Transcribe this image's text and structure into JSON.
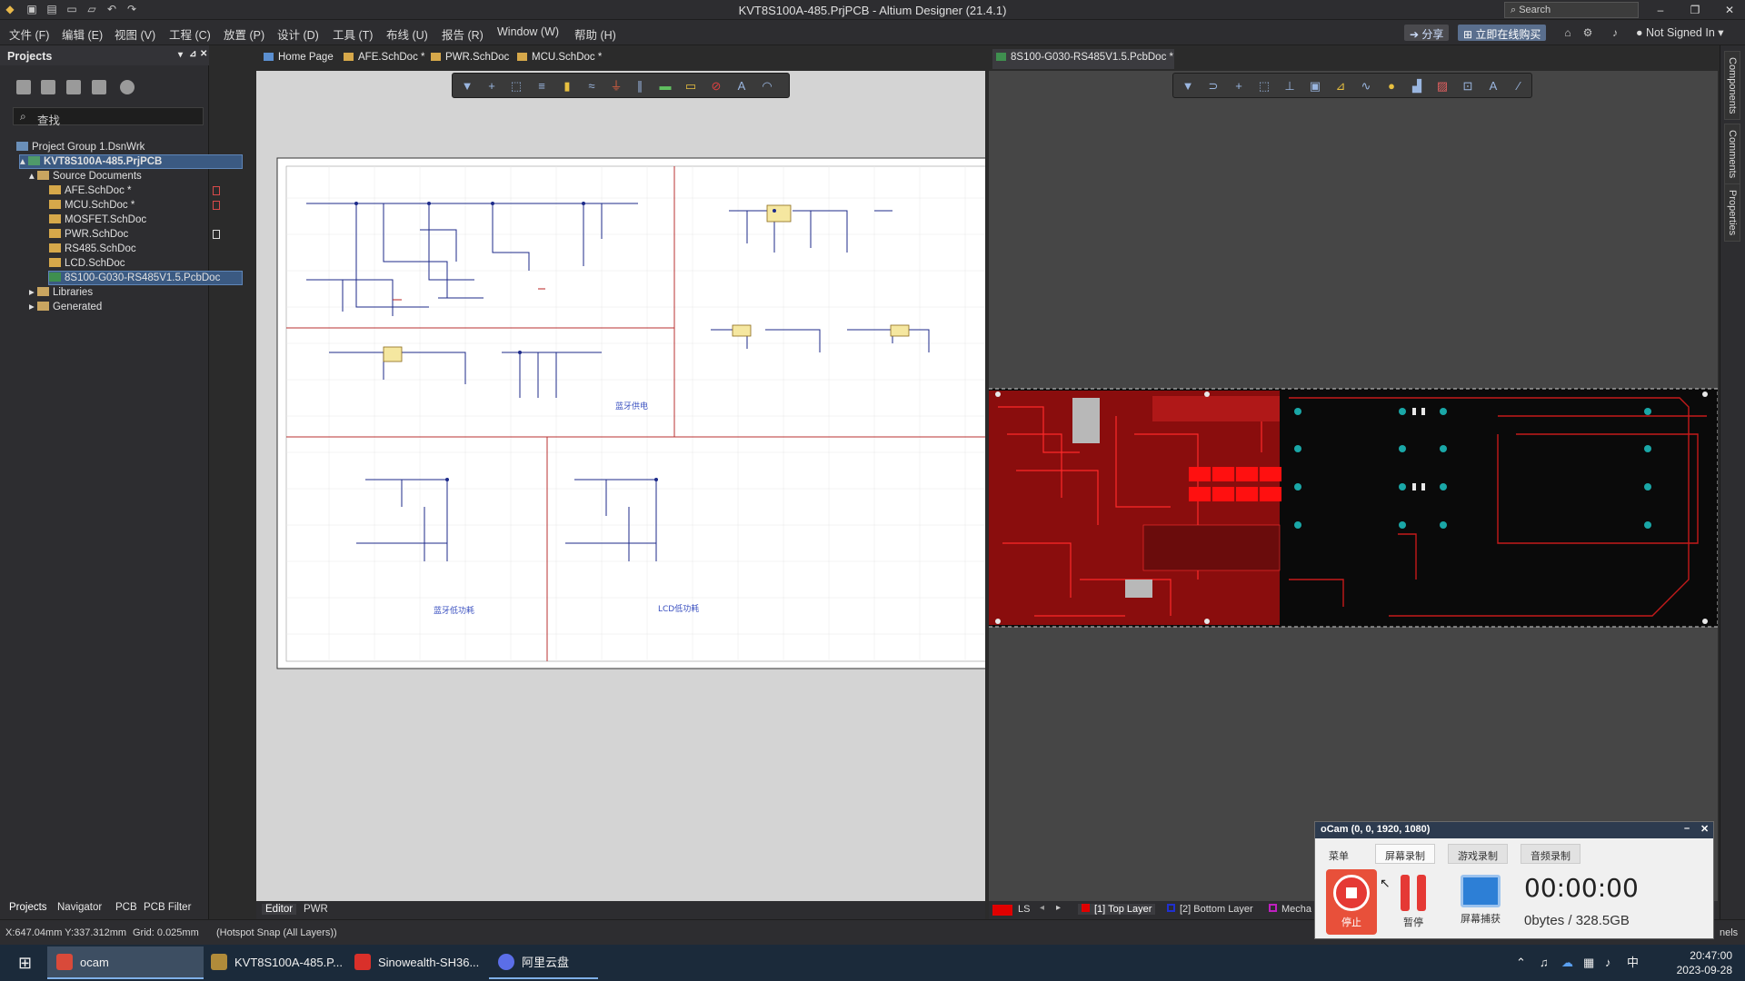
{
  "app": {
    "title": "KVT8S100A-485.PrjPCB - Altium Designer (21.4.1)",
    "search_placeholder": "Search",
    "share_label": "分享",
    "buy_label": "立即在线购买",
    "account_label": "Not Signed In"
  },
  "menu": [
    "文件 (F)",
    "编辑 (E)",
    "视图 (V)",
    "工程 (C)",
    "放置 (P)",
    "设计 (D)",
    "工具 (T)",
    "布线 (U)",
    "报告 (R)",
    "Window (W)",
    "帮助 (H)"
  ],
  "projects": {
    "title": "Projects",
    "search_placeholder": "查找",
    "group": "Project Group 1.DsnWrk",
    "project": "KVT8S100A-485.PrjPCB",
    "source_folder": "Source Documents",
    "files": [
      "AFE.SchDoc *",
      "MCU.SchDoc *",
      "MOSFET.SchDoc",
      "PWR.SchDoc",
      "RS485.SchDoc",
      "LCD.SchDoc",
      "8S100-G030-RS485V1.5.PcbDoc"
    ],
    "other_folders": [
      "Libraries",
      "Generated"
    ],
    "bottom_tabs": [
      "Projects",
      "Navigator",
      "PCB",
      "PCB Filter"
    ]
  },
  "doc_tabs": [
    "Home Page",
    "AFE.SchDoc *",
    "PWR.SchDoc",
    "MCU.SchDoc *"
  ],
  "pcb_tab": "8S100-G030-RS485V1.5.PcbDoc *",
  "schematic": {
    "notes": [
      "蓝牙供电",
      "蓝牙低功耗",
      "LCD低功耗"
    ]
  },
  "editor_tabs": [
    "Editor",
    "PWR"
  ],
  "layer_bar": {
    "ls": "LS",
    "layers": [
      {
        "label": "[1] Top Layer",
        "color": "#e00000"
      },
      {
        "label": "[2] Bottom Layer",
        "color": "#2030d0"
      },
      {
        "label": "Mecha",
        "color": "#c020c0"
      }
    ]
  },
  "right_panels": [
    "Components",
    "Comments",
    "Properties"
  ],
  "status": {
    "coords": "X:647.04mm Y:337.312mm",
    "grid": "Grid: 0.025mm",
    "snap": "(Hotspot Snap (All Layers))",
    "panels": "nels"
  },
  "ocam": {
    "title": "oCam (0, 0, 1920, 1080)",
    "tabs": [
      "菜单",
      "屏幕录制",
      "游戏录制",
      "音频录制"
    ],
    "stop_label": "停止",
    "pause_label": "暂停",
    "capture_label": "屏幕捕获",
    "timer": "00:00:00",
    "size": "0bytes / 328.5GB"
  },
  "taskbar": {
    "items": [
      "ocam",
      "KVT8S100A-485.P...",
      "Sinowealth-SH36...",
      "阿里云盘"
    ],
    "time": "20:47:00",
    "date": "2023-09-28",
    "ime": "中"
  },
  "colors": {
    "accent": "#3b5a82",
    "pcb_top": "#e00000",
    "record": "#e53935"
  }
}
